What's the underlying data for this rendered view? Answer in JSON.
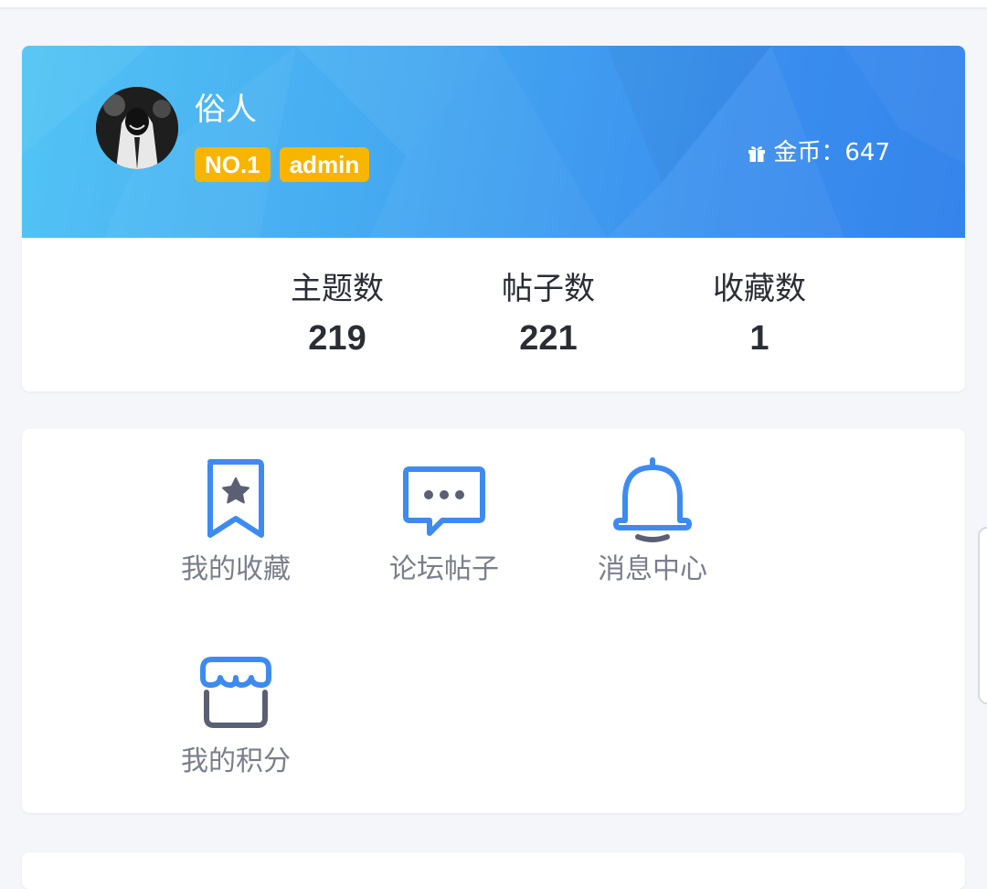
{
  "profile": {
    "username": "俗人",
    "badges": [
      "NO.1",
      "admin"
    ],
    "coins_label": "金币：647",
    "banner_colors": [
      "#52c4f4",
      "#3584ec"
    ],
    "badge_color": "#f7b500"
  },
  "stats": [
    {
      "label": "主题数",
      "value": "219"
    },
    {
      "label": "帖子数",
      "value": "221"
    },
    {
      "label": "收藏数",
      "value": "1"
    }
  ],
  "menu": [
    {
      "label": "我的收藏",
      "icon": "bookmark-star-icon"
    },
    {
      "label": "论坛帖子",
      "icon": "chat-bubble-icon"
    },
    {
      "label": "消息中心",
      "icon": "bell-icon"
    },
    {
      "label": "我的积分",
      "icon": "shop-icon"
    }
  ],
  "colors": {
    "icon_blue": "#3d8bf2",
    "icon_gray": "#5b5f73",
    "label_gray": "#7a7e8c"
  }
}
